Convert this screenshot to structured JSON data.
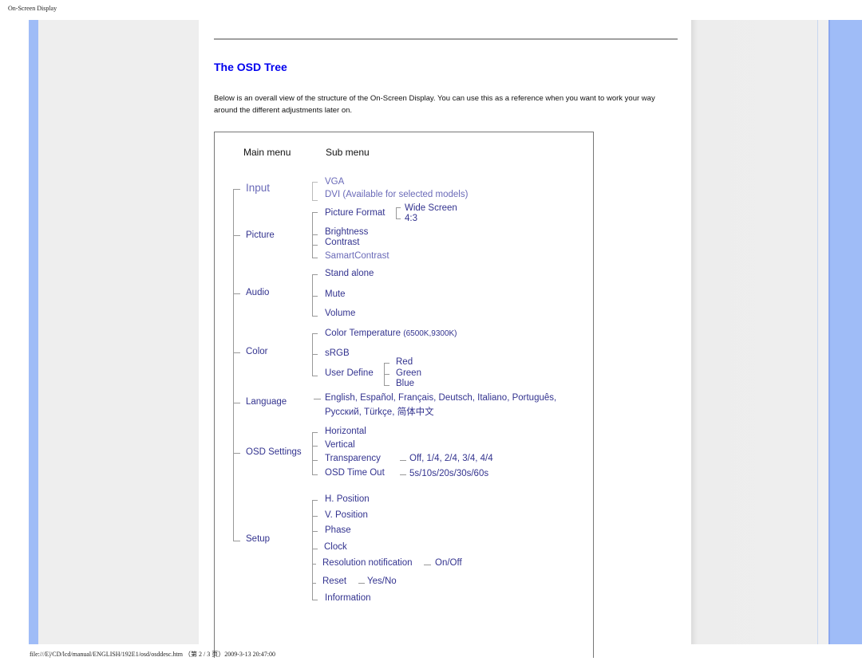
{
  "page_header": "On-Screen Display",
  "page_footer": "file:///E|/CD/lcd/manual/ENGLISH/192E1/osd/osddesc.htm （第 2 / 3 页）2009-3-13 20:47:00",
  "title": "The OSD Tree",
  "intro": "Below is an overall view of the structure of the On-Screen Display. You can use this as a reference when you want to work your way around the different adjustments later on.",
  "tree": {
    "headers": {
      "main": "Main menu",
      "sub": "Sub menu"
    },
    "input": {
      "label": "Input",
      "items": [
        "VGA",
        "DVI (Available for selected models)"
      ]
    },
    "picture": {
      "label": "Picture",
      "format": "Picture Format",
      "format_options": [
        "Wide Screen",
        "4:3"
      ],
      "items": [
        "Brightness",
        "Contrast",
        "SamartContrast"
      ]
    },
    "audio": {
      "label": "Audio",
      "items": [
        "Stand alone",
        "Mute",
        "Volume"
      ]
    },
    "color": {
      "label": "Color",
      "temp": "Color Temperature",
      "temp_values": "(6500K,9300K)",
      "srgb": "sRGB",
      "user": "User Define",
      "user_options": [
        "Red",
        "Green",
        "Blue"
      ]
    },
    "language": {
      "label": "Language",
      "line1": "English, Español, Français, Deutsch, Italiano, Português,",
      "line2": "Русский, Türkçe, 简体中文"
    },
    "osd": {
      "label": "OSD Settings",
      "items": [
        "Horizontal",
        "Vertical",
        "Transparency",
        "OSD Time Out"
      ],
      "transparency_values": "Off, 1/4, 2/4, 3/4, 4/4",
      "timeout_values": "5s/10s/20s/30s/60s"
    },
    "setup": {
      "label": "Setup",
      "items": [
        "H. Position",
        "V. Position",
        "Phase",
        "Clock",
        "Resolution notification",
        "Reset",
        "Information"
      ],
      "resolution_values": "On/Off",
      "reset_values": "Yes/No"
    }
  }
}
